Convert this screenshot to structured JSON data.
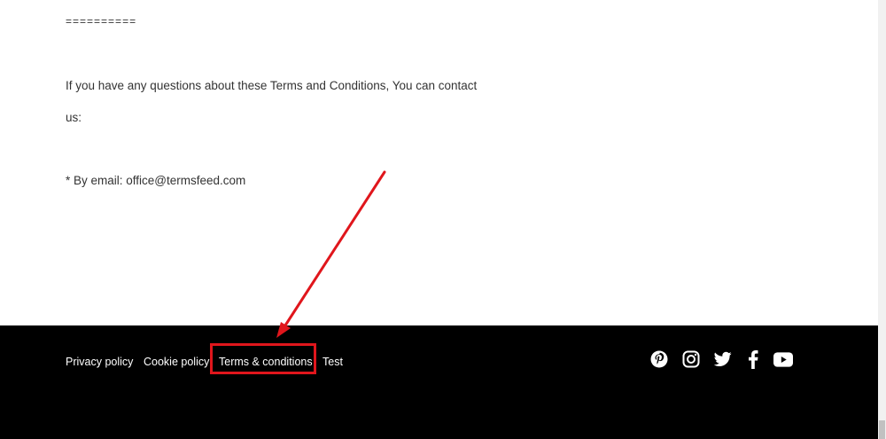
{
  "content": {
    "separator": "==========",
    "paragraph1": "If you have any questions about these Terms and Conditions, You can contact",
    "paragraph2": "us:",
    "email_line": "* By email: office@termsfeed.com"
  },
  "footer": {
    "links": [
      {
        "label": "Privacy policy"
      },
      {
        "label": "Cookie policy"
      },
      {
        "label": "Terms & conditions"
      },
      {
        "label": "Test"
      }
    ],
    "social": [
      "pinterest-icon",
      "instagram-icon",
      "twitter-icon",
      "facebook-icon",
      "youtube-icon"
    ]
  },
  "colors": {
    "text": "#333333",
    "footer_bg": "#000000",
    "footer_text": "#ffffff",
    "annotation": "#e0161c"
  }
}
